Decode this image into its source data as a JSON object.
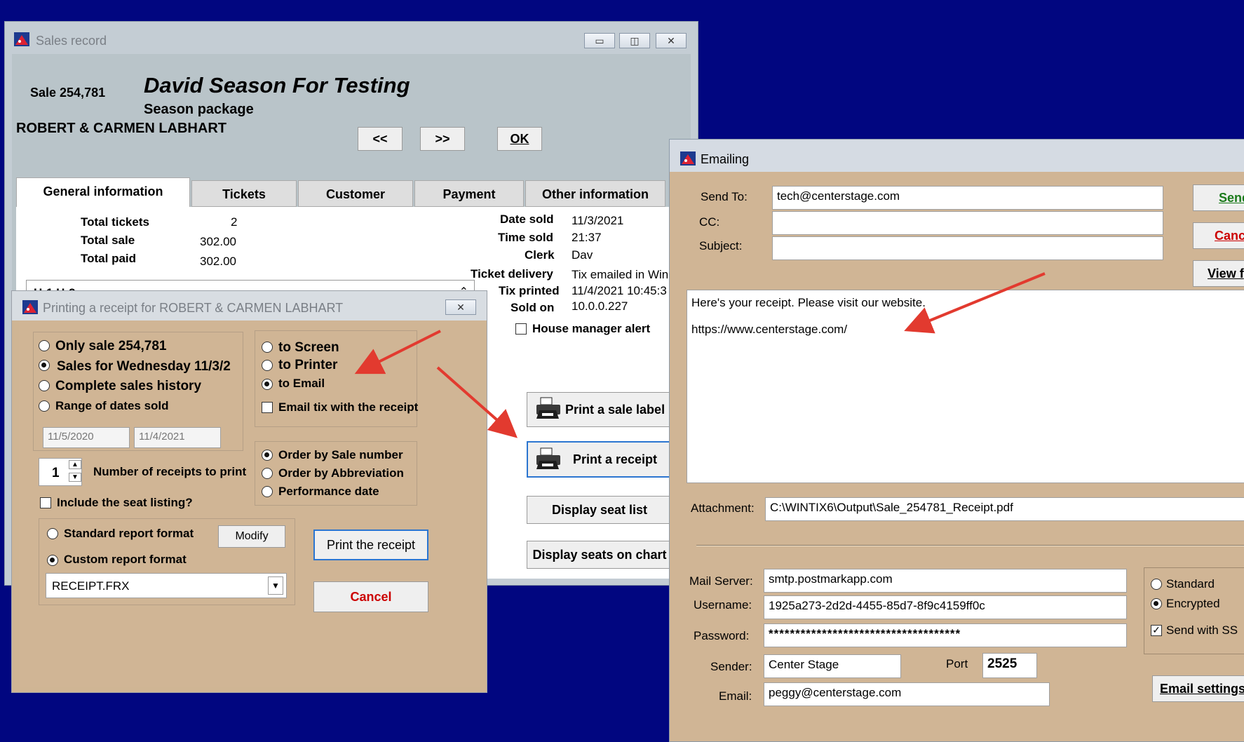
{
  "sales": {
    "title": "Sales record",
    "sale_label": "Sale 254,781",
    "event_title": "David Season For Testing",
    "event_sub": "Season package",
    "customer": "ROBERT & CARMEN LABHART",
    "nav_prev": "<<",
    "nav_next": ">>",
    "ok": "OK",
    "tabs": [
      "General information",
      "Tickets",
      "Customer",
      "Payment",
      "Other information"
    ],
    "total_tickets_label": "Total tickets",
    "total_tickets": "2",
    "total_sale_label": "Total sale",
    "total_sale": "302.00",
    "total_paid_label": "Total paid",
    "total_paid": "302.00",
    "seats": "H-1 H-2",
    "date_sold_label": "Date sold",
    "date_sold": "11/3/2021",
    "time_sold_label": "Time sold",
    "time_sold": "21:37",
    "clerk_label": "Clerk",
    "clerk": "Dav",
    "delivery_label": "Ticket delivery",
    "delivery": "Tix emailed in Win",
    "printed_label": "Tix printed",
    "printed": "11/4/2021 10:45:3",
    "sold_on_label": "Sold on",
    "sold_on": "10.0.0.227",
    "house_alert": "House manager alert",
    "btn_sale_label": "Print a sale label",
    "btn_receipt": "Print a receipt",
    "btn_seat_list": "Display seat list",
    "btn_seats_chart": "Display seats on chart"
  },
  "print": {
    "title": "Printing a receipt for ROBERT & CARMEN LABHART",
    "opt_only": "Only sale 254,781",
    "opt_wed": "Sales for Wednesday 11/3/2",
    "opt_complete": "Complete sales history",
    "opt_range": "Range of dates sold",
    "date_from": "11/5/2020",
    "date_to": "11/4/2021",
    "to_screen": "to Screen",
    "to_printer": "to Printer",
    "to_email": "to Email",
    "email_tix": "Email tix with the receipt",
    "order_sale": "Order by Sale number",
    "order_abbr": "Order by Abbreviation",
    "order_perf": "Performance date",
    "count": "1",
    "count_label": "Number of receipts to print",
    "include_seat": "Include the seat listing?",
    "std_format": "Standard report format",
    "modify": "Modify",
    "custom_format": "Custom report format",
    "report_file": "RECEIPT.FRX",
    "print_btn": "Print the receipt",
    "cancel_btn": "Cancel"
  },
  "email": {
    "title": "Emailing",
    "send_to_label": "Send To:",
    "send_to": "tech@centerstage.com",
    "cc_label": "CC:",
    "subject_label": "Subject:",
    "btn_send": "Send",
    "btn_cancel": "Cancel",
    "btn_view": "View f",
    "body_line1": "Here's your receipt. Please visit our website.",
    "body_line2": "https://www.centerstage.com/",
    "attach_label": "Attachment:",
    "attachment": "C:\\WINTIX6\\Output\\Sale_254781_Receipt.pdf",
    "server_label": "Mail Server:",
    "server": "smtp.postmarkapp.com",
    "user_label": "Username:",
    "user": "1925a273-2d2d-4455-85d7-8f9c4159ff0c",
    "pass_label": "Password:",
    "pass": "************************************",
    "sender_label": "Sender:",
    "sender": "Center Stage",
    "port_label": "Port",
    "port": "2525",
    "email_label": "Email:",
    "email": "peggy@centerstage.com",
    "standard": "Standard",
    "encrypted": "Encrypted",
    "send_ssl": "Send with SS",
    "settings_btn": "Email settings"
  },
  "colors": {
    "desktop": "#010680",
    "dialog": "#d0b595",
    "window_gray": "#b9c4c9",
    "arrow": "#e23a2f"
  }
}
